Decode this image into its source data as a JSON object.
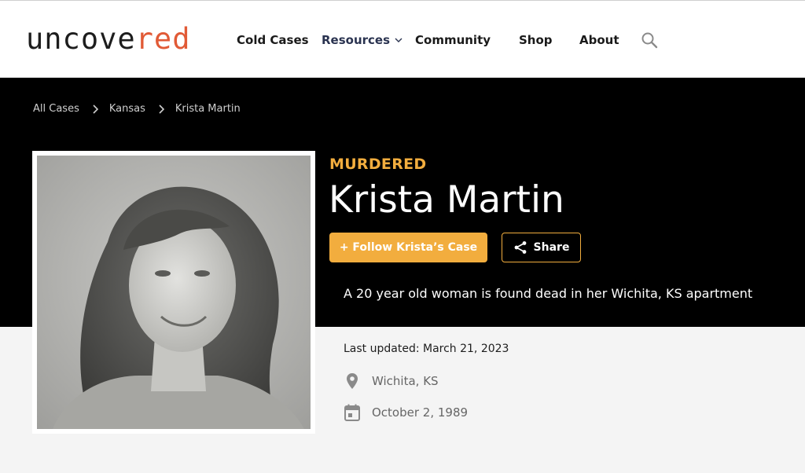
{
  "header": {
    "logo": {
      "main": "uncove",
      "accent": "red"
    },
    "nav": [
      {
        "label": "Cold Cases"
      },
      {
        "label": "Resources"
      },
      {
        "label": "Community"
      },
      {
        "label": "Shop"
      },
      {
        "label": "About"
      }
    ],
    "search_icon": "search-icon"
  },
  "breadcrumb": [
    "All Cases",
    "Kansas",
    "Krista Martin"
  ],
  "case": {
    "status": "MURDERED",
    "name": "Krista Martin",
    "follow_label": "+ Follow Krista’s Case",
    "share_label": "Share",
    "summary": "A 20 year old woman is found dead in her Wichita, KS apartment",
    "last_updated": "Last updated: March 21, 2023",
    "location": "Wichita, KS",
    "date": "October 2, 1989"
  },
  "colors": {
    "accent": "#f2ad3e",
    "logo_accent": "#e15a36",
    "hero_bg": "#000000",
    "page_bg": "#f4f4f4"
  }
}
